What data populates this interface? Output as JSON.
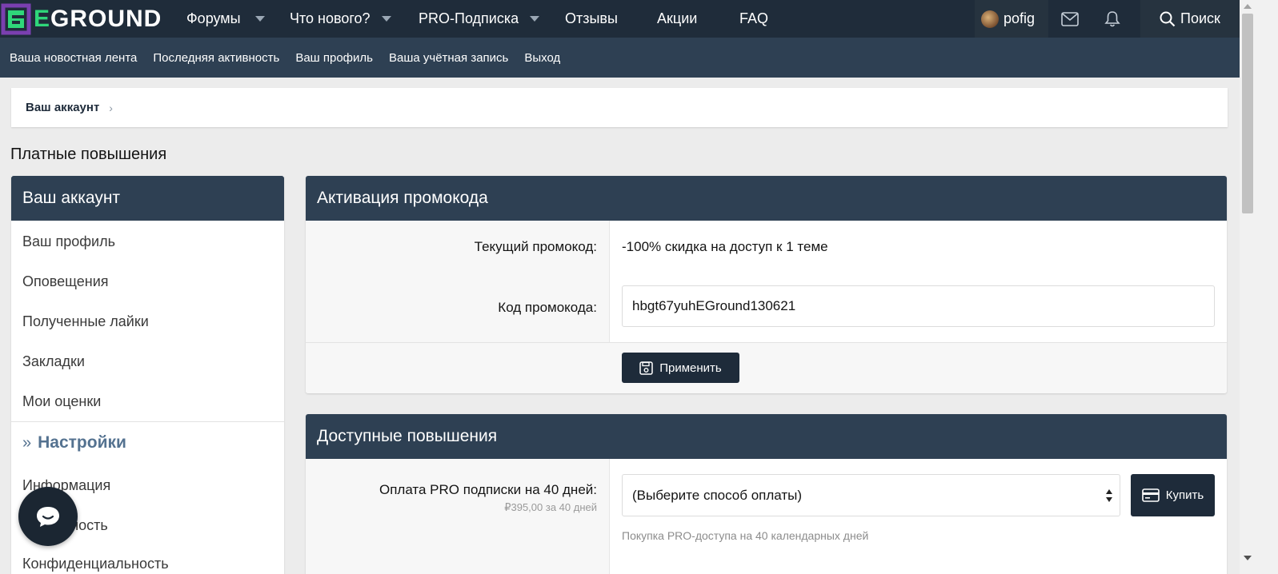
{
  "brand": {
    "logo_first": "E",
    "logo_rest": "GROUND"
  },
  "nav": {
    "items": [
      {
        "label": "Форумы",
        "dropdown": true
      },
      {
        "label": "Что нового?",
        "dropdown": true
      },
      {
        "label": "PRO-Подписка",
        "dropdown": true
      },
      {
        "label": "Отзывы",
        "dropdown": false
      },
      {
        "label": "Акции",
        "dropdown": false
      },
      {
        "label": "FAQ",
        "dropdown": false
      }
    ],
    "username": "pofig",
    "search_label": "Поиск"
  },
  "subnav": {
    "links": [
      "Ваша новостная лента",
      "Последняя активность",
      "Ваш профиль",
      "Ваша учётная запись",
      "Выход"
    ]
  },
  "breadcrumb": {
    "item": "Ваш аккаунт",
    "sep": "›"
  },
  "page": {
    "title": "Платные повышения"
  },
  "sidebar": {
    "header": "Ваш аккаунт",
    "items": [
      "Ваш профиль",
      "Оповещения",
      "Полученные лайки",
      "Закладки",
      "Мои оценки"
    ],
    "section_chevron": "»",
    "section_title": "Настройки",
    "section_items": [
      "Информация",
      "Приватность",
      "Конфиденциальность"
    ]
  },
  "promo": {
    "header": "Активация промокода",
    "current_label": "Текущий промокод:",
    "current_value": "-100% скидка на доступ к 1 теме",
    "code_label": "Код промокода:",
    "code_value": "hbgt67yuhEGround130621",
    "apply_label": "Применить"
  },
  "upgrades": {
    "header": "Доступные повышения",
    "item_label": "Оплата PRO подписки на 40 дней:",
    "item_price": "₽395,00 за 40 дней",
    "select_value": "(Выберите способ оплаты)",
    "buy_label": "Купить",
    "explain": "Покупка PRO-доступа на 40 календарных дней"
  },
  "colors": {
    "topbar": "#1f2c3a",
    "subbar": "#2e4053",
    "accent_green": "#2fd67a",
    "button": "#1e2b3a",
    "section": "#547290"
  }
}
